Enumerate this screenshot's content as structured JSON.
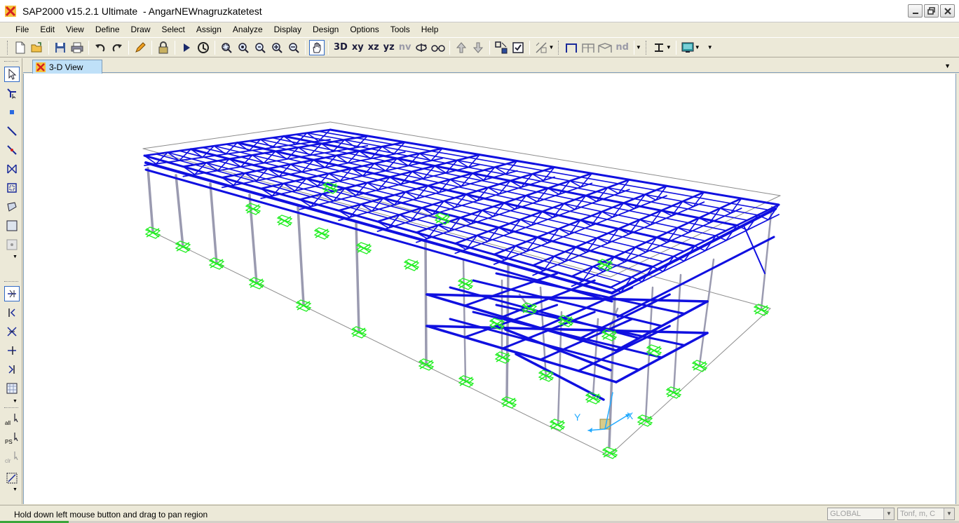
{
  "window": {
    "title": "SAP2000 v15.2.1 Ultimate  - AngarNEWnagruzkatetest"
  },
  "menu": [
    "File",
    "Edit",
    "View",
    "Define",
    "Draw",
    "Select",
    "Assign",
    "Analyze",
    "Display",
    "Design",
    "Options",
    "Tools",
    "Help"
  ],
  "toolbar": {
    "view_xy": "xy",
    "view_xz": "xz",
    "view_yz": "yz",
    "view_nv": "nv",
    "view_3d": "3D",
    "nd_label": "nd"
  },
  "view_tab": {
    "label": "3-D View"
  },
  "axes": {
    "x": "X",
    "y": "Y"
  },
  "left_toolbar": {
    "all_label": "all",
    "ps_label": "PS",
    "clr_label": "clr"
  },
  "status": {
    "message": "Hold down left mouse button and drag to pan region",
    "coord_system": "GLOBAL",
    "units": "Tonf, m, C"
  },
  "colors": {
    "frame": "#1010e0",
    "column": "#9a9ab0",
    "support": "#22ee22",
    "axis": "#22aaff",
    "bounding": "#8c8c8c"
  }
}
